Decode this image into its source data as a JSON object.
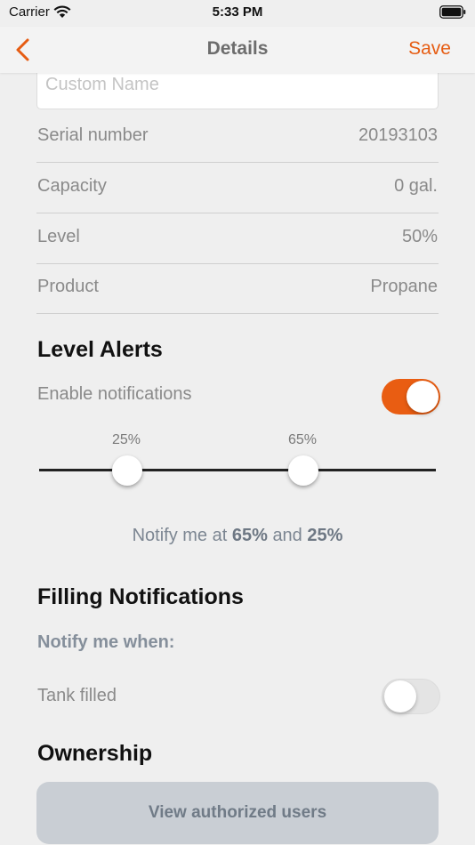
{
  "status_bar": {
    "carrier": "Carrier",
    "time": "5:33 PM"
  },
  "nav": {
    "title": "Details",
    "save_label": "Save",
    "back_icon": "chevron-left-icon",
    "accent_color": "#e65c12"
  },
  "custom_name": {
    "placeholder": "Custom Name",
    "value": ""
  },
  "info_rows": [
    {
      "label": "Serial number",
      "value": "20193103"
    },
    {
      "label": "Capacity",
      "value": "0 gal."
    },
    {
      "label": "Level",
      "value": "50%"
    },
    {
      "label": "Product",
      "value": "Propane"
    }
  ],
  "level_alerts": {
    "title": "Level Alerts",
    "enable_label": "Enable notifications",
    "enabled": true,
    "slider": {
      "low_label": "25%",
      "high_label": "65%",
      "low_value": 25,
      "high_value": 65
    },
    "summary_prefix": "Notify me at",
    "summary_high": "65%",
    "summary_and": "and",
    "summary_low": "25%"
  },
  "filling": {
    "title": "Filling Notifications",
    "subheading": "Notify me when:",
    "tank_filled_label": "Tank filled",
    "tank_filled_enabled": false
  },
  "ownership": {
    "title": "Ownership",
    "button_label": "View authorized users"
  }
}
